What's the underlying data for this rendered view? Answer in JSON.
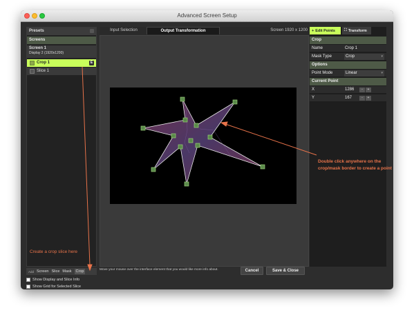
{
  "window": {
    "title": "Advanced Screen Setup"
  },
  "left": {
    "presets_label": "Presets",
    "screens_header": "Screens",
    "screen": {
      "name": "Screen 1",
      "detail": "Display 2 (1920x1200)"
    },
    "slices": [
      {
        "label": "Crop 1",
        "badge": "E",
        "selected": true
      },
      {
        "label": "Slice 1",
        "selected": false
      }
    ],
    "hint": "Create a crop slice here",
    "toolbar": {
      "add": "Add",
      "items": [
        "Screen",
        "Slice",
        "Mask",
        "Crop"
      ]
    },
    "options": [
      "Show Display and Slice Info",
      "Show Grid for Selected Slice"
    ]
  },
  "tabs": [
    "Input Selection",
    "Output Transformation"
  ],
  "screen_res": "Screen  1920 x 1200",
  "status_text": "Move your mouse over the interface element that you would like more info about.",
  "buttons": {
    "cancel": "Cancel",
    "save": "Save & Close"
  },
  "right": {
    "tools": {
      "edit": "Edit Points",
      "transform": "Transform"
    },
    "crop_header": "Crop",
    "name_label": "Name",
    "name_value": "Crop 1",
    "mask_type_label": "Mask Type",
    "mask_type_value": "Crop",
    "options_header": "Options",
    "point_mode_label": "Point Mode",
    "point_mode_value": "Linear",
    "current_point_header": "Current Point",
    "x_label": "X",
    "x_value": "1286",
    "y_label": "Y",
    "y_value": "167",
    "stepper_minus": "-",
    "stepper_plus": "+"
  },
  "annotation": "Double click anywhere on the crop/mask border to create a point",
  "colors": {
    "accent": "#c9ff5b",
    "annotation": "#e8734a",
    "section": "#4e5a47"
  }
}
